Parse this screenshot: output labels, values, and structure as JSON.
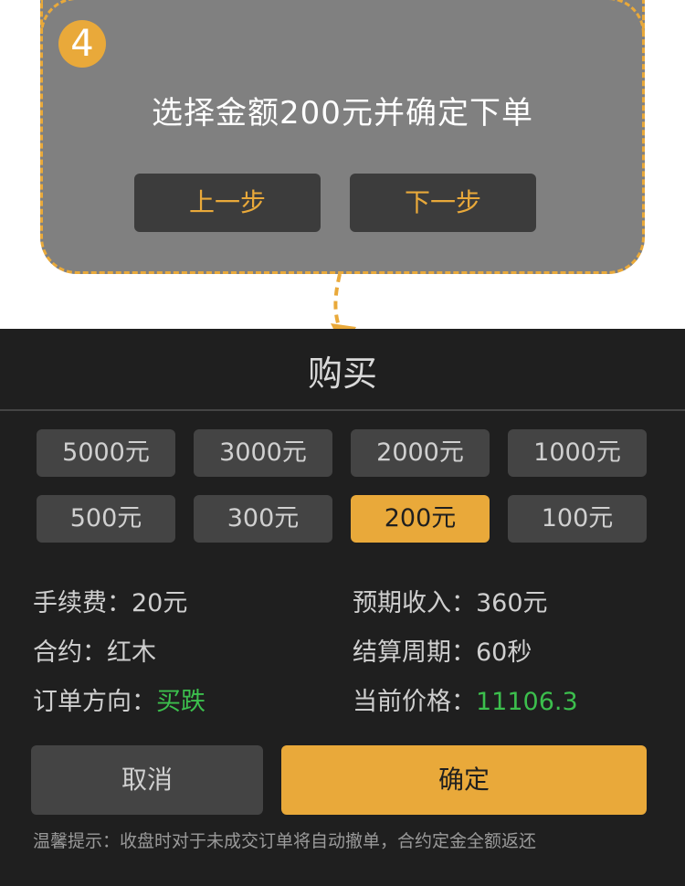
{
  "tutorial": {
    "step_number": "4",
    "instruction": "选择金额200元并确定下单",
    "prev_label": "上一步",
    "next_label": "下一步"
  },
  "purchase": {
    "title": "购买",
    "amounts": [
      "5000元",
      "3000元",
      "2000元",
      "1000元",
      "500元",
      "300元",
      "200元",
      "100元"
    ],
    "selected_amount": "200元",
    "fee_label": "手续费：",
    "fee_value": "20元",
    "expected_income_label": "预期收入：",
    "expected_income_value": "360元",
    "contract_label": "合约：",
    "contract_value": "红木",
    "settlement_label": "结算周期：",
    "settlement_value": "60秒",
    "direction_label": "订单方向：",
    "direction_value": "买跌",
    "price_label": "当前价格：",
    "price_value": "11106.3",
    "cancel_label": "取消",
    "confirm_label": "确定",
    "notice": "温馨提示：收盘时对于未成交订单将自动撤单，合约定金全额返还"
  },
  "colors": {
    "accent": "#e9a93a",
    "panel_bg": "#1f1f1f",
    "button_bg": "#444444",
    "positive_green": "#3cbf4d"
  }
}
